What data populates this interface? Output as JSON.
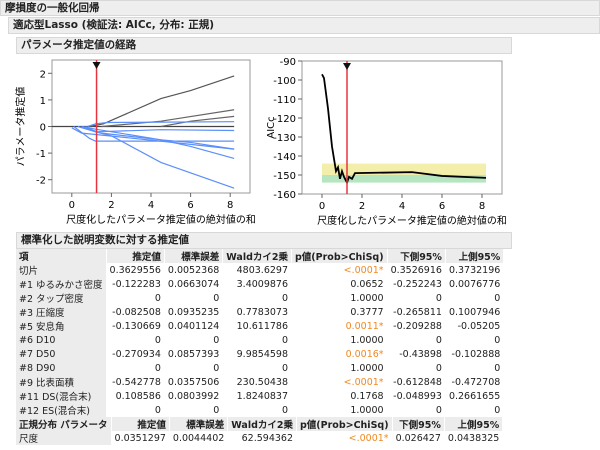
{
  "title": "摩損度の一般化回帰",
  "model_header": "適応型Lasso (検証法: AICc, 分布: 正規)",
  "path_header": "パラメータ推定値の経路",
  "chart_data": [
    {
      "type": "line",
      "title": "",
      "xlabel": "尺度化したパラメータ推定値の絶対値の和",
      "ylabel": "パラメータ推定値",
      "xlim": [
        -1,
        9
      ],
      "ylim": [
        -2.5,
        2.5
      ],
      "xticks": [
        "0",
        "2",
        "4",
        "6",
        "8"
      ],
      "yticks": [
        "2",
        "1",
        "0",
        "-1",
        "-2"
      ],
      "selected_x": 1.25,
      "series": [
        {
          "name": "zero",
          "color": "#444444",
          "points": [
            [
              -1,
              0
            ],
            [
              8.2,
              0
            ]
          ]
        },
        {
          "name": "gray1",
          "color": "#555555",
          "points": [
            [
              0.9,
              0
            ],
            [
              1.6,
              0.1
            ],
            [
              4.5,
              1.05
            ],
            [
              6,
              1.35
            ],
            [
              8.2,
              1.9
            ]
          ]
        },
        {
          "name": "gray2",
          "color": "#666666",
          "points": [
            [
              1.5,
              0
            ],
            [
              4.5,
              0.2
            ],
            [
              8.2,
              0.63
            ]
          ]
        },
        {
          "name": "gray3",
          "color": "#666666",
          "points": [
            [
              4.5,
              0
            ],
            [
              6,
              0.2
            ],
            [
              8.2,
              0.38
            ]
          ]
        },
        {
          "name": "blue1",
          "color": "#5b8ff9",
          "points": [
            [
              0.8,
              0
            ],
            [
              1.2,
              0.1
            ],
            [
              1.8,
              0.15
            ],
            [
              8.2,
              0.18
            ]
          ]
        },
        {
          "name": "blue2",
          "color": "#5b8ff9",
          "points": [
            [
              0.7,
              0
            ],
            [
              1.2,
              -0.2
            ],
            [
              4.5,
              -0.12
            ],
            [
              8.2,
              -0.15
            ]
          ]
        },
        {
          "name": "blue3",
          "color": "#5b8ff9",
          "points": [
            [
              0,
              -0.05
            ],
            [
              0.5,
              -0.25
            ],
            [
              1.2,
              -0.3
            ],
            [
              4.5,
              -0.55
            ],
            [
              8.2,
              -0.55
            ]
          ]
        },
        {
          "name": "blue4",
          "color": "#5b8ff9",
          "points": [
            [
              0.1,
              0
            ],
            [
              0.9,
              -0.45
            ],
            [
              1.2,
              -0.55
            ],
            [
              4.5,
              -0.55
            ],
            [
              8.2,
              -0.85
            ]
          ]
        },
        {
          "name": "blue5",
          "color": "#5b8ff9",
          "points": [
            [
              0.5,
              0
            ],
            [
              1.5,
              -0.25
            ],
            [
              4.5,
              -0.5
            ],
            [
              6,
              -0.75
            ],
            [
              8.2,
              -1.2
            ]
          ]
        },
        {
          "name": "blue6",
          "color": "#5b8ff9",
          "points": [
            [
              0.3,
              0
            ],
            [
              1.2,
              -0.2
            ],
            [
              2,
              -0.35
            ],
            [
              4.5,
              -1.35
            ],
            [
              8.2,
              -2.32
            ]
          ]
        },
        {
          "name": "blue7",
          "color": "#5b8ff9",
          "points": [
            [
              0.5,
              0
            ],
            [
              1.2,
              -0.1
            ],
            [
              4.5,
              -0.5
            ],
            [
              6,
              -0.6
            ],
            [
              8.2,
              -0.85
            ]
          ]
        }
      ]
    },
    {
      "type": "line",
      "title": "",
      "xlabel": "尺度化したパラメータ推定値の絶対値の和",
      "ylabel": "AICc",
      "xlim": [
        -1,
        9
      ],
      "ylim": [
        -160,
        -90
      ],
      "xticks": [
        "0",
        "2",
        "4",
        "6",
        "8"
      ],
      "yticks": [
        "-90",
        "-100",
        "-110",
        "-120",
        "-130",
        "-140",
        "-150",
        "-160"
      ],
      "selected_x": 1.25,
      "bands": [
        {
          "from": -150,
          "to": -144,
          "color": "#f3eeaa"
        },
        {
          "from": -154,
          "to": -150,
          "color": "#b6e6bf"
        }
      ],
      "series": [
        {
          "name": "AICc",
          "color": "#000000",
          "points": [
            [
              0,
              -97
            ],
            [
              0.1,
              -99
            ],
            [
              0.3,
              -115
            ],
            [
              0.5,
              -135
            ],
            [
              0.7,
              -148
            ],
            [
              0.8,
              -146
            ],
            [
              0.9,
              -152
            ],
            [
              1.0,
              -148
            ],
            [
              1.1,
              -151
            ],
            [
              1.25,
              -154
            ],
            [
              1.35,
              -151
            ],
            [
              1.5,
              -152
            ],
            [
              1.65,
              -149
            ],
            [
              4.5,
              -148.5
            ],
            [
              6,
              -150.5
            ],
            [
              8.2,
              -151.5
            ]
          ]
        }
      ]
    }
  ],
  "estimates": {
    "header": "標準化した説明変数に対する推定値",
    "columns": [
      "項",
      "推定値",
      "標準誤差",
      "Waldカイ2乗",
      "p値(Prob>ChiSq)",
      "下側95%",
      "上側95%"
    ],
    "rows": [
      [
        "切片",
        "0.3629556",
        "0.0052368",
        "4803.6297",
        "<.0001*",
        "0.3526916",
        "0.3732196"
      ],
      [
        "#1 ゆるみかさ密度",
        "-0.122283",
        "0.0663074",
        "3.4009876",
        "0.0652",
        "-0.252243",
        "0.0076776"
      ],
      [
        "#2 タップ密度",
        "0",
        "0",
        "0",
        "1.0000",
        "0",
        "0"
      ],
      [
        "#3 圧縮度",
        "-0.082508",
        "0.0935235",
        "0.7783073",
        "0.3777",
        "-0.265811",
        "0.1007946"
      ],
      [
        "#5 安息角",
        "-0.130669",
        "0.0401124",
        "10.611786",
        "0.0011*",
        "-0.209288",
        "-0.05205"
      ],
      [
        "#6 D10",
        "0",
        "0",
        "0",
        "1.0000",
        "0",
        "0"
      ],
      [
        "#7 D50",
        "-0.270934",
        "0.0857393",
        "9.9854598",
        "0.0016*",
        "-0.43898",
        "-0.102888"
      ],
      [
        "#8 D90",
        "0",
        "0",
        "0",
        "1.0000",
        "0",
        "0"
      ],
      [
        "#9 比表面積",
        "-0.542778",
        "0.0357506",
        "230.50438",
        "<.0001*",
        "-0.612848",
        "-0.472708"
      ],
      [
        "#11 DS(混合末)",
        "0.108586",
        "0.0803992",
        "1.8240837",
        "0.1768",
        "-0.048993",
        "0.2661655"
      ],
      [
        "#12 ES(混合末)",
        "0",
        "0",
        "0",
        "1.0000",
        "0",
        "0"
      ]
    ]
  },
  "normal": {
    "columns": [
      "正規分布 パラメータ",
      "推定値",
      "標準誤差",
      "Waldカイ2乗",
      "p値(Prob>ChiSq)",
      "下側95%",
      "上側95%"
    ],
    "rows": [
      [
        "尺度",
        "0.0351297",
        "0.0044402",
        "62.594362",
        "<.0001*",
        "0.026427",
        "0.0438325"
      ]
    ]
  }
}
